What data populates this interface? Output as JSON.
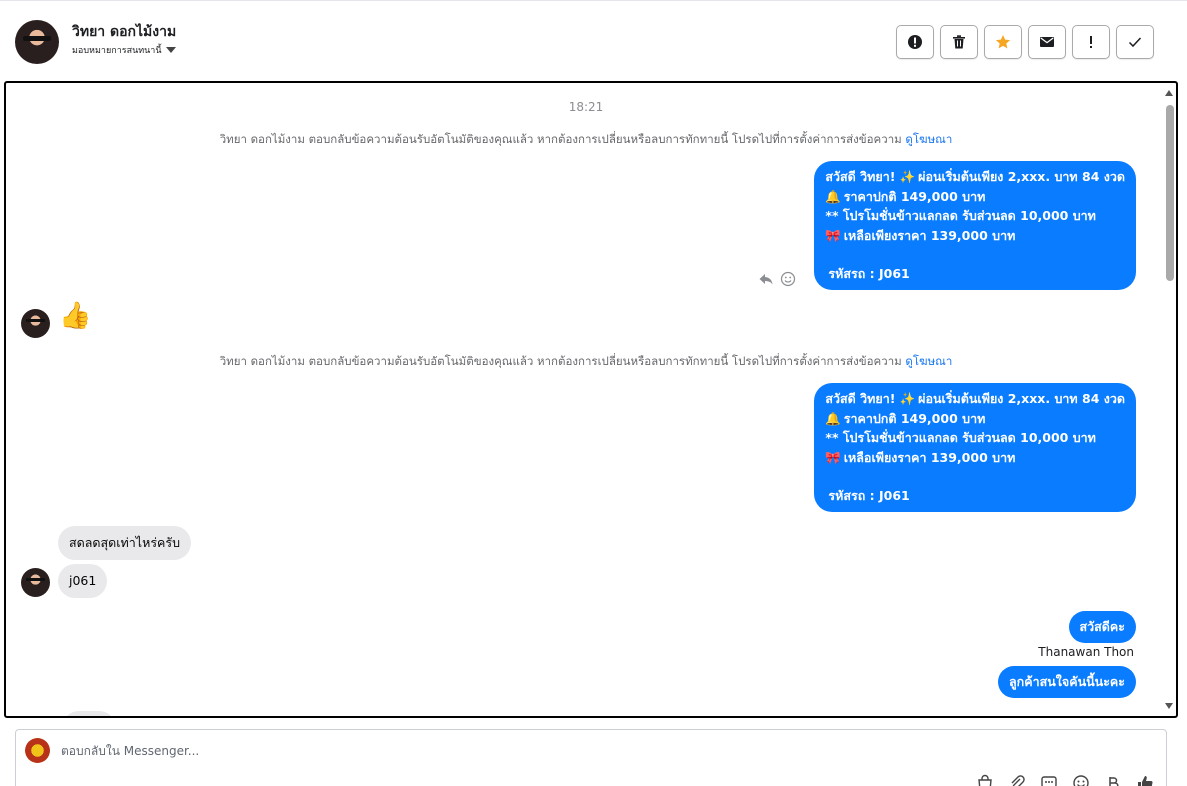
{
  "header": {
    "contact_name": "วิทยา ดอกไม้งาม",
    "assign_label": "มอบหมายการสนทนานี้",
    "actions": [
      {
        "name": "report-button",
        "icon": "alert-circle-icon",
        "label": "!"
      },
      {
        "name": "delete-button",
        "icon": "trash-icon",
        "label": ""
      },
      {
        "name": "star-button",
        "icon": "star-icon",
        "label": ""
      },
      {
        "name": "mark-unread-button",
        "icon": "envelope-icon",
        "label": ""
      },
      {
        "name": "follow-up-button",
        "icon": "exclamation-icon",
        "label": "!"
      },
      {
        "name": "mark-done-button",
        "icon": "check-icon",
        "label": ""
      }
    ]
  },
  "conversation": {
    "timestamp": "18:21",
    "system_note": {
      "text": "วิทยา ดอกไม้งาม ตอบกลับข้อความต้อนรับอัตโนมัติของคุณแล้ว หากต้องการเปลี่ยนหรือลบการทักทายนี้ โปรดไปที่การตั้งค่าการส่งข้อความ ",
      "link": "ดูโฆษณา"
    },
    "promo_message": {
      "line1_a": "สวัสดี วิทยา! ",
      "line1_emoji": "✨",
      "line1_b": " ผ่อนเริ่มต้นเพียง 2,xxx. บาท 84 งวด",
      "line2_emoji": "🔔",
      "line2": " ราคาปกติ 149,000 บาท",
      "line3": "** โปรโมชั่นข้าวแลกลด รับส่วนลด 10,000 บาท",
      "line4_emoji": "🎀",
      "line4": " เหลือเพียงราคา 139,000 บาท",
      "line5": "รหัสรถ : J061"
    },
    "incoming": {
      "thumbs_up": "👍",
      "msg1": "สดลดสุดเท่าไหร่ครับ",
      "msg2": "j061"
    },
    "outgoing": {
      "greeting": "สวัสดีคะ",
      "sender": "Thanawan Thon",
      "reply": "ลูกค้าสนใจคันนี้นะคะ"
    }
  },
  "composer": {
    "placeholder": "ตอบกลับใน Messenger...",
    "tools": [
      "shop-bag-icon",
      "paperclip-icon",
      "chat-template-icon",
      "emoji-icon",
      "baht-icon",
      "like-icon"
    ]
  },
  "colors": {
    "bubble_out": "#0a7cff",
    "bubble_in": "#e9e9eb",
    "link": "#1876f2",
    "star": "#f5a623"
  }
}
